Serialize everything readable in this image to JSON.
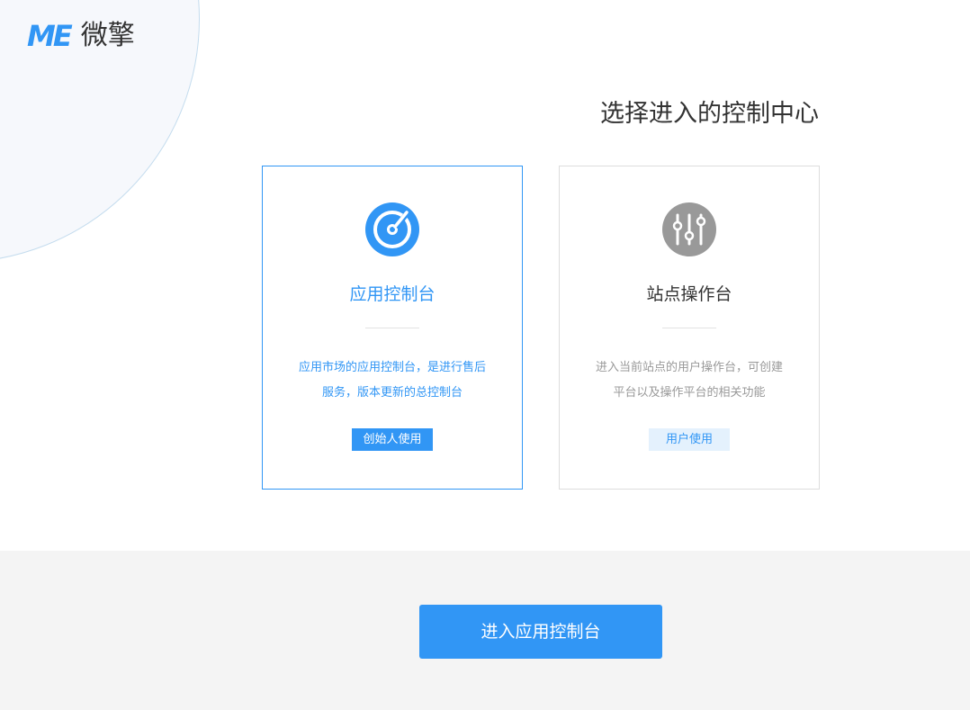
{
  "logo": {
    "mark": "ME",
    "text": "微擎"
  },
  "heading": "选择进入的控制中心",
  "colors": {
    "accent": "#3196f5",
    "accent_light": "#e4f1fd",
    "muted_icon": "#999999",
    "footer_bg": "#f4f4f4"
  },
  "cards": [
    {
      "icon": "target-icon",
      "title": "应用控制台",
      "desc_line1": "应用市场的应用控制台，是进行售后",
      "desc_line2": "服务，版本更新的总控制台",
      "tag": "创始人使用",
      "selected": true
    },
    {
      "icon": "sliders-icon",
      "title": "站点操作台",
      "desc_line1": "进入当前站点的用户操作台，可创建",
      "desc_line2": "平台以及操作平台的相关功能",
      "tag": "用户使用",
      "selected": false
    }
  ],
  "footer": {
    "enter_button_label": "进入应用控制台"
  }
}
